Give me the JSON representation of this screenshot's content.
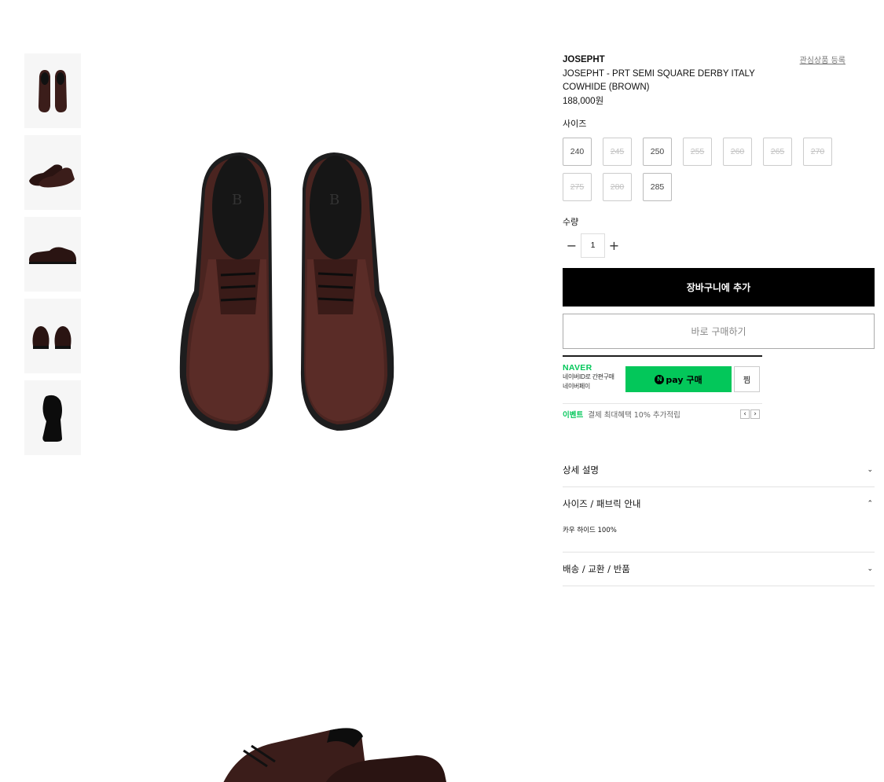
{
  "product": {
    "brand": "JOSEPHT",
    "wishlist_label": "관심상품 등록",
    "name": "JOSEPHT - PRT SEMI SQUARE DERBY ITALY COWHIDE (BROWN)",
    "price": "188,000원"
  },
  "thumbnails": [
    {
      "icon": "shoes-top-view-icon"
    },
    {
      "icon": "shoes-angle-view-icon"
    },
    {
      "icon": "shoe-side-view-icon"
    },
    {
      "icon": "shoes-back-view-icon"
    },
    {
      "icon": "shoe-sole-view-icon"
    }
  ],
  "size": {
    "label": "사이즈",
    "options": [
      {
        "value": "240",
        "sold_out": false
      },
      {
        "value": "245",
        "sold_out": true
      },
      {
        "value": "250",
        "sold_out": false
      },
      {
        "value": "255",
        "sold_out": true
      },
      {
        "value": "260",
        "sold_out": true
      },
      {
        "value": "265",
        "sold_out": true
      },
      {
        "value": "270",
        "sold_out": true
      },
      {
        "value": "275",
        "sold_out": true
      },
      {
        "value": "280",
        "sold_out": true
      },
      {
        "value": "285",
        "sold_out": false
      }
    ]
  },
  "quantity": {
    "label": "수량",
    "minus": "−",
    "value": "1",
    "plus": "+"
  },
  "actions": {
    "add_to_cart": "장바구니에 추가",
    "buy_now": "바로 구매하기"
  },
  "naver_pay": {
    "logo": "NAVER",
    "sub_line1": "네이버ID로 간편구매",
    "sub_line2": "네이버페이",
    "n_glyph": "N",
    "button_label": "pay 구매",
    "wish_label": "찜",
    "event_tag": "이벤트",
    "event_text": "결제 최대혜택 10% 추가적립",
    "prev": "‹",
    "next": "›",
    "color": "#03c75a"
  },
  "accordion": [
    {
      "title": "상세 설명",
      "expanded": false,
      "chevron": "⌄"
    },
    {
      "title": "사이즈 / 패브릭 안내",
      "expanded": true,
      "chevron": "⌃",
      "body": "카우 하이드 100%"
    },
    {
      "title": "배송 / 교환 / 반품",
      "expanded": false,
      "chevron": "⌄"
    }
  ]
}
